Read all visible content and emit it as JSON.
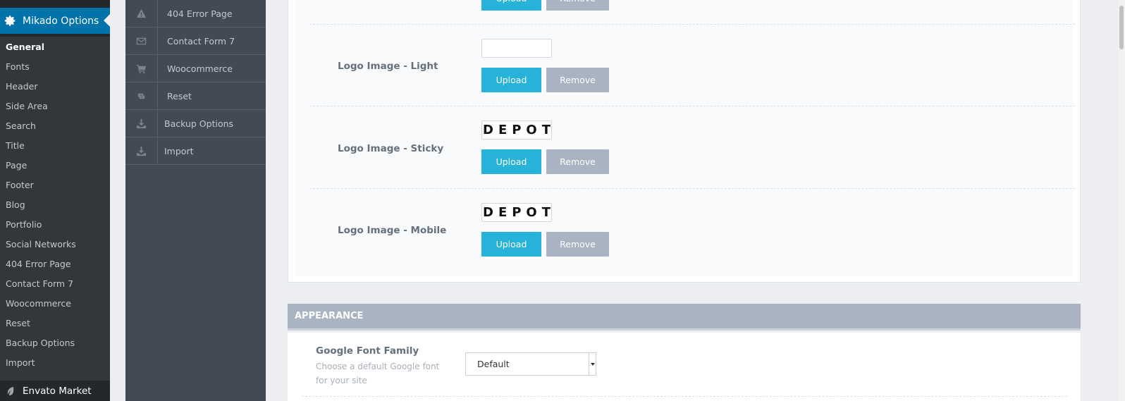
{
  "wp_menu": {
    "active_label": "Mikado Options",
    "submenu": [
      {
        "label": "General",
        "current": true
      },
      {
        "label": "Fonts"
      },
      {
        "label": "Header"
      },
      {
        "label": "Side Area"
      },
      {
        "label": "Search"
      },
      {
        "label": "Title"
      },
      {
        "label": "Page"
      },
      {
        "label": "Footer"
      },
      {
        "label": "Blog"
      },
      {
        "label": "Portfolio"
      },
      {
        "label": "Social Networks"
      },
      {
        "label": "404 Error Page"
      },
      {
        "label": "Contact Form 7"
      },
      {
        "label": "Woocommerce"
      },
      {
        "label": "Reset"
      },
      {
        "label": "Backup Options"
      },
      {
        "label": "Import"
      }
    ],
    "next_label": "Envato Market"
  },
  "options_nav": [
    {
      "label": "404 Error Page",
      "icon": "warning-icon"
    },
    {
      "label": "Contact Form 7",
      "icon": "envelope-icon"
    },
    {
      "label": "Woocommerce",
      "icon": "cart-icon"
    },
    {
      "label": "Reset",
      "icon": "retweet-icon"
    },
    {
      "label": "Backup Options",
      "icon": "download-icon"
    },
    {
      "label": "Import",
      "icon": "download-icon"
    }
  ],
  "buttons": {
    "upload": "Upload",
    "remove": "Remove"
  },
  "logo_rows": [
    {
      "label": "Logo Image - Light",
      "preview": ""
    },
    {
      "label": "Logo Image - Sticky",
      "preview": "DEPOT"
    },
    {
      "label": "Logo Image - Mobile",
      "preview": "DEPOT"
    }
  ],
  "appearance": {
    "title": "APPEARANCE",
    "google_font": {
      "label": "Google Font Family",
      "description": "Choose a default Google font for your site",
      "value": "Default"
    }
  },
  "colors": {
    "upload": "#27b3d9",
    "remove": "#a9b3c2",
    "wp_active": "#0073aa"
  }
}
